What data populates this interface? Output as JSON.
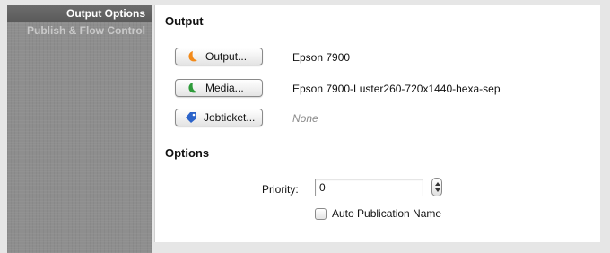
{
  "sidebar": {
    "items": [
      {
        "label": "Output Options"
      },
      {
        "label": "Publish & Flow Control"
      }
    ]
  },
  "output_section": {
    "title": "Output",
    "rows": [
      {
        "button_label": "Output...",
        "value": "Epson 7900",
        "icon": "orange-crescent-icon"
      },
      {
        "button_label": "Media...",
        "value": "Epson 7900-Luster260-720x1440-hexa-sep",
        "icon": "green-crescent-icon"
      },
      {
        "button_label": "Jobticket...",
        "value": "None",
        "icon": "blue-tag-icon"
      }
    ]
  },
  "options_section": {
    "title": "Options",
    "priority_label": "Priority:",
    "priority_value": "0",
    "auto_publication_label": "Auto Publication Name",
    "auto_publication_checked": false
  },
  "colors": {
    "output_icon": "#f28a1a",
    "media_icon": "#2e9b3a",
    "jobticket_icon": "#2b63c9"
  }
}
